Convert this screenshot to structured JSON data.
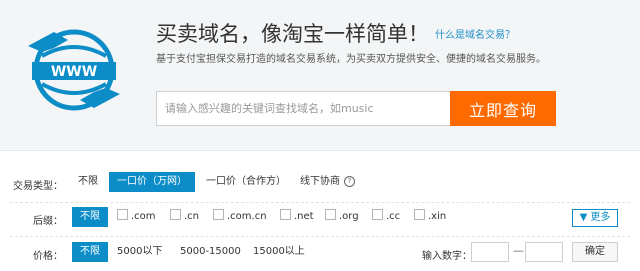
{
  "hero": {
    "slogan": "买卖域名，像淘宝一样简单！",
    "slogan_link": "什么是域名交易？",
    "subtitle": "基于支付宝担保交易打造的域名交易系统，为买卖双方提供安全、便捷的域名交易服务。",
    "search_placeholder": "请输入感兴趣的关键词查找域名，如music",
    "search_button": "立即查询",
    "logo_text": "WWW",
    "brand_color": "#0c8dc8",
    "accent_color": "#ff6a00"
  },
  "filters": {
    "trade_type": {
      "label": "交易类型：",
      "options": [
        "不限",
        "一口价（万网）",
        "一口价（合作方）",
        "线下协商"
      ],
      "selected": "一口价（万网）"
    },
    "suffix": {
      "label": "后缀：",
      "options": [
        "不限",
        ".com",
        ".cn",
        ".com.cn",
        ".net",
        ".org",
        ".cc",
        ".xin"
      ],
      "selected": "不限",
      "more": "▼ 更多"
    },
    "price": {
      "label": "价格：",
      "options": [
        "不限",
        "5000以下",
        "5000-15000",
        "15000以上"
      ],
      "selected": "不限",
      "number_label": "输入数字：",
      "dash": "—",
      "confirm": "确定"
    }
  }
}
